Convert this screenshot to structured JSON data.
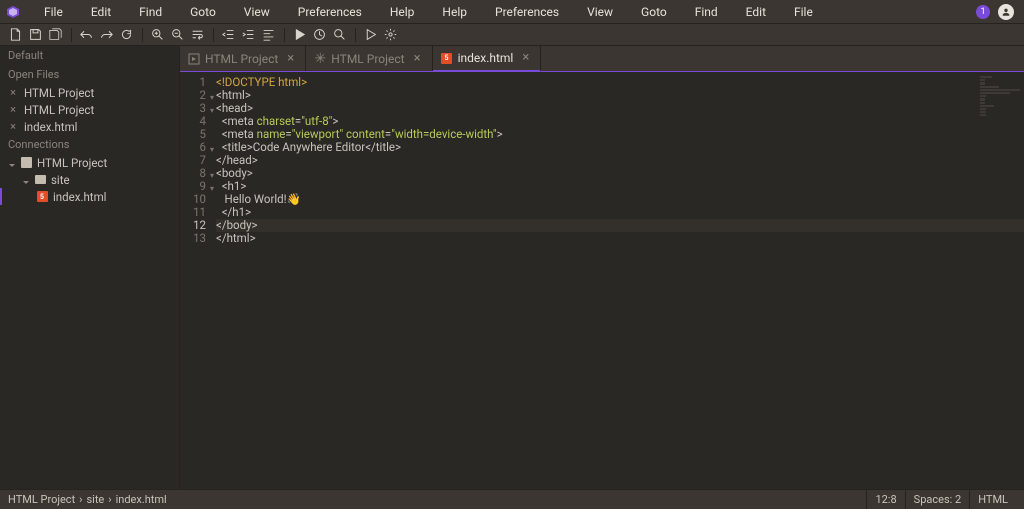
{
  "menu": {
    "items": [
      "File",
      "Edit",
      "Find",
      "Goto",
      "View",
      "Preferences",
      "Help"
    ],
    "badge": "1"
  },
  "sidebar": {
    "defaultLabel": "Default",
    "openFilesLabel": "Open Files",
    "openFiles": [
      "HTML Project",
      "HTML Project",
      "index.html"
    ],
    "connectionsLabel": "Connections",
    "project": "HTML Project",
    "folder": "site",
    "file": "index.html"
  },
  "tabs": [
    {
      "label": "HTML Project",
      "kind": "preview",
      "active": false,
      "close": true
    },
    {
      "label": "HTML Project",
      "kind": "not-saved",
      "active": false,
      "close": true
    },
    {
      "label": "index.html",
      "kind": "html",
      "active": true,
      "close": true
    }
  ],
  "code": {
    "lines": [
      {
        "n": 1,
        "fold": false,
        "current": false,
        "segs": [
          {
            "c": "c-decl",
            "t": "<!DOCTYPE html>"
          }
        ]
      },
      {
        "n": 2,
        "fold": true,
        "current": false,
        "segs": [
          {
            "c": "c-tag",
            "t": "<html>"
          }
        ]
      },
      {
        "n": 3,
        "fold": true,
        "current": false,
        "segs": [
          {
            "c": "c-tag",
            "t": "<head>"
          }
        ]
      },
      {
        "n": 4,
        "fold": false,
        "current": false,
        "segs": [
          {
            "c": "c-tag",
            "t": "  <meta "
          },
          {
            "c": "c-attr",
            "t": "charset"
          },
          {
            "c": "c-tag",
            "t": "="
          },
          {
            "c": "c-str",
            "t": "\"utf-8\""
          },
          {
            "c": "c-tag",
            "t": ">"
          }
        ]
      },
      {
        "n": 5,
        "fold": false,
        "current": false,
        "segs": [
          {
            "c": "c-tag",
            "t": "  <meta "
          },
          {
            "c": "c-attr",
            "t": "name"
          },
          {
            "c": "c-tag",
            "t": "="
          },
          {
            "c": "c-str",
            "t": "\"viewport\""
          },
          {
            "c": "c-tag",
            "t": " "
          },
          {
            "c": "c-attr",
            "t": "content"
          },
          {
            "c": "c-tag",
            "t": "="
          },
          {
            "c": "c-str",
            "t": "\"width=device-width\""
          },
          {
            "c": "c-tag",
            "t": ">"
          }
        ]
      },
      {
        "n": 6,
        "fold": true,
        "current": false,
        "segs": [
          {
            "c": "c-tag",
            "t": "  <title>"
          },
          {
            "c": "c-txt",
            "t": "Code Anywhere Editor"
          },
          {
            "c": "c-tag",
            "t": "</title>"
          }
        ]
      },
      {
        "n": 7,
        "fold": false,
        "current": false,
        "segs": [
          {
            "c": "c-tag",
            "t": "</head>"
          }
        ]
      },
      {
        "n": 8,
        "fold": true,
        "current": false,
        "segs": [
          {
            "c": "c-tag",
            "t": "<body>"
          }
        ]
      },
      {
        "n": 9,
        "fold": true,
        "current": false,
        "segs": [
          {
            "c": "c-tag",
            "t": "  <h1>"
          }
        ]
      },
      {
        "n": 10,
        "fold": false,
        "current": false,
        "segs": [
          {
            "c": "c-txt",
            "t": "   Hello World!👋"
          }
        ]
      },
      {
        "n": 11,
        "fold": false,
        "current": false,
        "segs": [
          {
            "c": "c-tag",
            "t": "  </h1>"
          }
        ]
      },
      {
        "n": 12,
        "fold": false,
        "current": true,
        "segs": [
          {
            "c": "c-tag",
            "t": "</body>"
          }
        ]
      },
      {
        "n": 13,
        "fold": false,
        "current": false,
        "segs": [
          {
            "c": "c-tag",
            "t": "</html>"
          }
        ]
      }
    ]
  },
  "status": {
    "breadcrumb": [
      "HTML Project",
      "site",
      "index.html"
    ],
    "cursor": "12:8",
    "spaces": "Spaces: 2",
    "lang": "HTML"
  }
}
